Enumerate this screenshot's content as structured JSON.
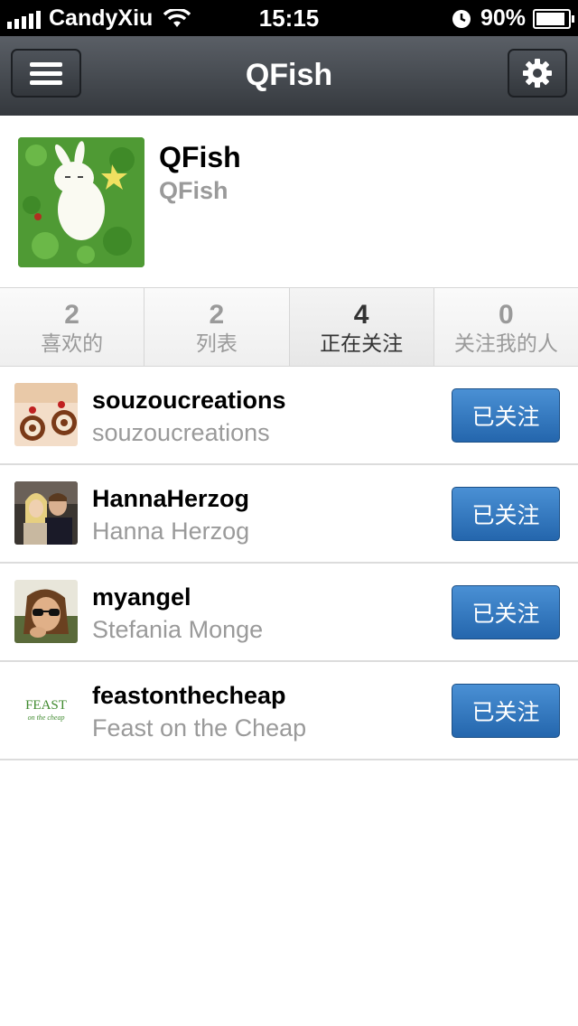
{
  "statusbar": {
    "carrier": "CandyXiu",
    "time": "15:15",
    "battery": "90%"
  },
  "navbar": {
    "title": "QFish"
  },
  "profile": {
    "name": "QFish",
    "handle": "QFish"
  },
  "tabs": [
    {
      "count": "2",
      "label": "喜欢的"
    },
    {
      "count": "2",
      "label": "列表"
    },
    {
      "count": "4",
      "label": "正在关注"
    },
    {
      "count": "0",
      "label": "关注我的人"
    }
  ],
  "users": [
    {
      "username": "souzoucreations",
      "fullname": "souzoucreations",
      "button": "已关注"
    },
    {
      "username": "HannaHerzog",
      "fullname": "Hanna Herzog",
      "button": "已关注"
    },
    {
      "username": "myangel",
      "fullname": "Stefania Monge",
      "button": "已关注"
    },
    {
      "username": "feastonthecheap",
      "fullname": "Feast on the Cheap",
      "button": "已关注"
    }
  ],
  "thumb_logo": {
    "line1": "FEAST",
    "line2": "on the cheap"
  },
  "colors": {
    "accent": "#2466ad",
    "navbar": "#3f444a"
  }
}
